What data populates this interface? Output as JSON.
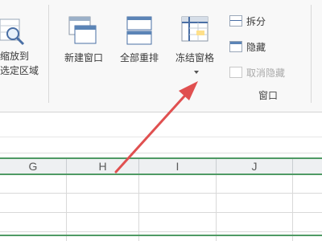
{
  "ribbon": {
    "zoom_selection_line1": "缩放到",
    "zoom_selection_line2": "选定区域",
    "new_window": "新建窗口",
    "arrange_all": "全部重排",
    "freeze_panes": "冻结窗格",
    "split": "拆分",
    "hide": "隐藏",
    "unhide": "取消隐藏",
    "group_window": "窗口"
  },
  "sheet": {
    "columns": [
      "G",
      "H",
      "I",
      "J"
    ]
  },
  "colors": {
    "accent_green": "#4f9a64",
    "arrow_red": "#e05050"
  }
}
